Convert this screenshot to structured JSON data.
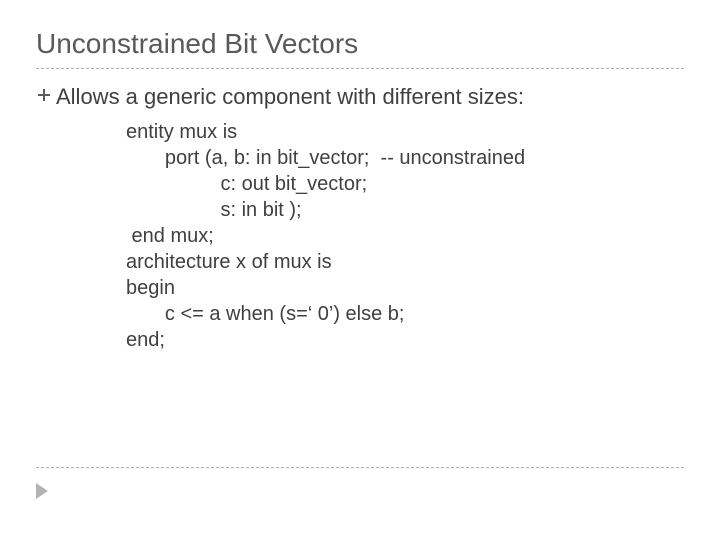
{
  "title": "Unconstrained Bit Vectors",
  "bullet": "Allows a generic component with different sizes:",
  "code": {
    "l1": "entity mux is",
    "l2": "       port (a, b: in bit_vector;  -- unconstrained",
    "l3": "                 c: out bit_vector;",
    "l4": "                 s: in bit );",
    "l5": " end mux;",
    "l6": "architecture x of mux is",
    "l7": "begin",
    "l8": "       c <= a when (s=‘ 0’) else b;",
    "l9": "end;"
  }
}
